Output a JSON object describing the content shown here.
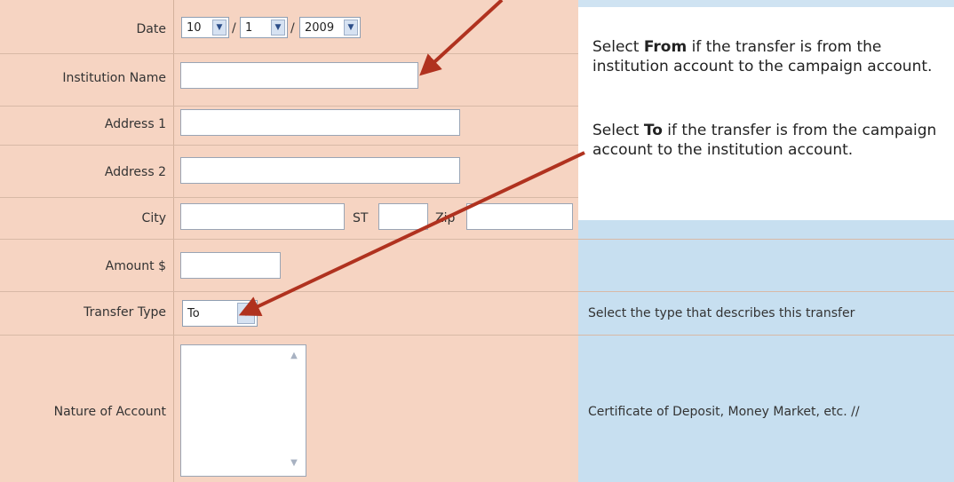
{
  "form": {
    "date": {
      "label": "Date",
      "month": "10",
      "day": "1",
      "year": "2009",
      "separator": "/"
    },
    "institution_name": {
      "label": "Institution Name",
      "value": ""
    },
    "address1": {
      "label": "Address 1",
      "value": ""
    },
    "address2": {
      "label": "Address 2",
      "value": ""
    },
    "city": {
      "label": "City",
      "value": "",
      "st_label": "ST",
      "st_value": "",
      "zip_label": "Zip",
      "zip_value": ""
    },
    "amount": {
      "label": "Amount $",
      "value": ""
    },
    "transfer_type": {
      "label": "Transfer Type",
      "value": "To",
      "help": "Select the type that describes this transfer"
    },
    "nature_of_account": {
      "label": "Nature of Account",
      "value": "",
      "help": "Certificate of Deposit, Money Market, etc. //"
    }
  },
  "note": {
    "p1_pre": "Select ",
    "p1_bold": "From",
    "p1_post": " if the transfer is from the institution account to the campaign account.",
    "p2_pre": "Select ",
    "p2_bold": "To",
    "p2_post": " if the transfer is from the campaign account to the institution account."
  },
  "colors": {
    "left_panel": "#f6d4c2",
    "right_panel": "#c7dff0",
    "arrow": "#b0321f"
  },
  "icons": {
    "select_arrow": "chevron-down-icon",
    "scroll_up": "scroll-up-icon",
    "scroll_down": "scroll-down-icon"
  }
}
